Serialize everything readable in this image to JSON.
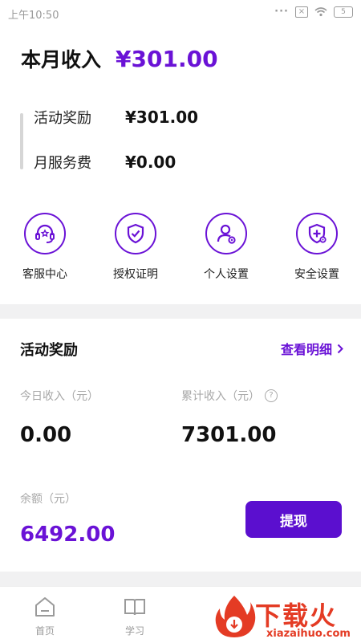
{
  "status_bar": {
    "time": "上午10:50",
    "battery": "5"
  },
  "summary": {
    "month_label": "本月收入",
    "month_value": "¥301.00"
  },
  "breakdown": [
    {
      "label": "活动奖励",
      "value": "¥301.00"
    },
    {
      "label": "月服务费",
      "value": "¥0.00"
    }
  ],
  "shortcuts": [
    {
      "label": "客服中心",
      "icon": "headset-icon"
    },
    {
      "label": "授权证明",
      "icon": "shield-check-icon"
    },
    {
      "label": "个人设置",
      "icon": "user-settings-icon"
    },
    {
      "label": "安全设置",
      "icon": "shield-plus-icon"
    }
  ],
  "rewards": {
    "title": "活动奖励",
    "detail_link": "查看明细",
    "today_label": "今日收入（元）",
    "today_value": "0.00",
    "total_label": "累计收入（元）",
    "total_value": "7301.00",
    "balance_label": "余额（元）",
    "balance_value": "6492.00",
    "withdraw_label": "提现"
  },
  "tabs": [
    {
      "label": "首页",
      "icon": "home-icon"
    },
    {
      "label": "学习",
      "icon": "book-icon"
    }
  ],
  "watermark": {
    "cn": "下载火",
    "en": "xiazaihuo.com"
  },
  "colors": {
    "accent": "#6a12d6",
    "button": "#5b0fcf",
    "watermark": "#e43b24"
  }
}
